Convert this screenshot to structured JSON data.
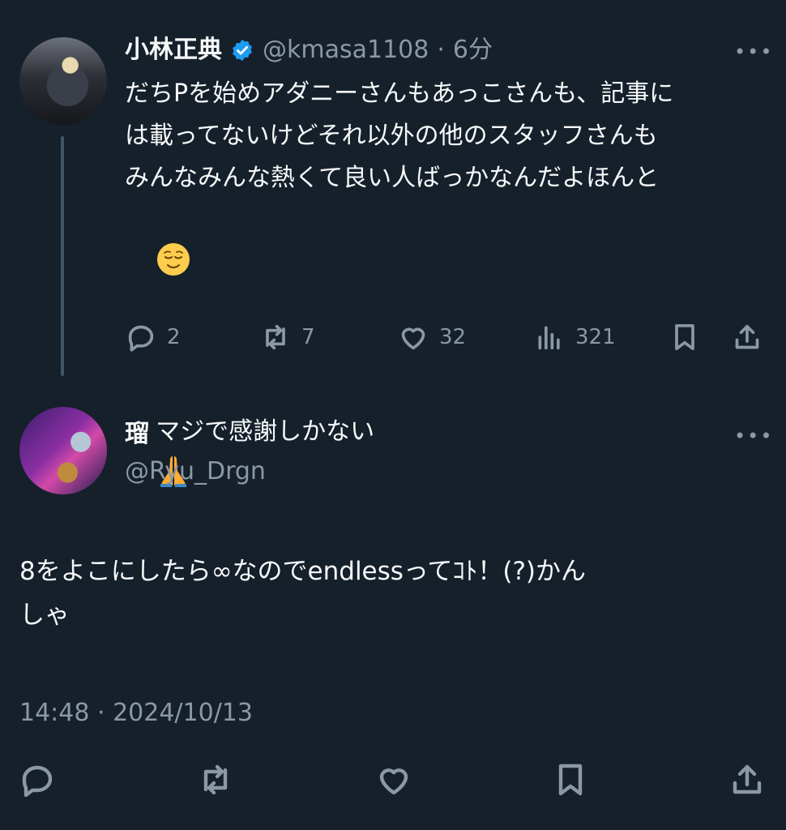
{
  "parent_tweet": {
    "author_name": "小林正典",
    "handle": "@kmasa1108",
    "separator": "·",
    "time": "6分",
    "lines": [
      "だちPを始めアダニーさんもあっこさんも、記事に",
      "は載ってないけどそれ以外の他のスタッフさんも",
      "みんなみんな熱くて良い人ばっかなんだよほんと"
    ],
    "line4_emoji": "relieved-face-emoji",
    "line5": "マジで感謝しかない",
    "line5_emoji": "folded-hands-emoji",
    "replies": "2",
    "retweets": "7",
    "likes": "32",
    "views": "321"
  },
  "main_tweet": {
    "author_name": "瑠",
    "handle": "@Ryu_Drgn",
    "lines": [
      "8をよこにしたら∞なのでendlessってｺﾄ！(?)かん",
      "しゃ"
    ],
    "timestamp": "14:48 · 2024/10/13"
  },
  "colors": {
    "background": "#15202b",
    "text": "#f7f9f9",
    "secondary": "#8b98a5",
    "verified": "#1d9bf0",
    "thread_line": "#425466"
  },
  "more_label": "•••"
}
